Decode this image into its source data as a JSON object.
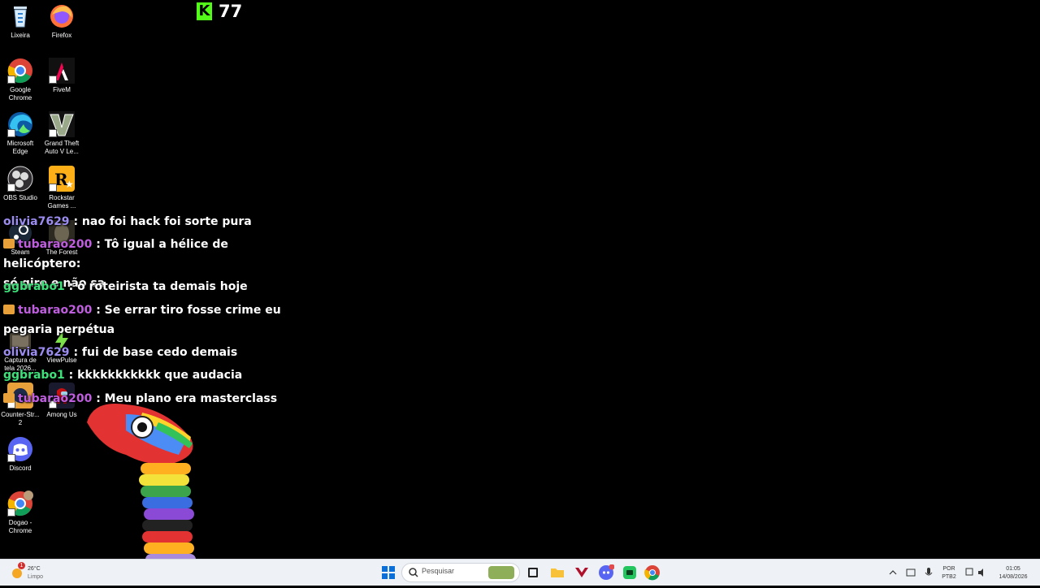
{
  "desktop": {
    "icons": [
      {
        "label": "Lixeira"
      },
      {
        "label": "Firefox"
      },
      {
        "label": "Google Chrome"
      },
      {
        "label": "FiveM"
      },
      {
        "label": "Microsoft Edge"
      },
      {
        "label": "Grand Theft Auto V Le..."
      },
      {
        "label": "OBS Studio"
      },
      {
        "label": "Rockstar Games ..."
      },
      {
        "label": "Steam"
      },
      {
        "label": "The Forest"
      },
      {
        "label": "Captura de tela 2026..."
      },
      {
        "label": "ViewPulse"
      },
      {
        "label": "Counter-Str... 2"
      },
      {
        "label": "Among Us"
      },
      {
        "label": "Discord"
      },
      {
        "label": "Dogao - Chrome"
      }
    ]
  },
  "counter": {
    "logo_letter": "K",
    "value": "77",
    "logo_color": "#53fc18"
  },
  "chat": {
    "clipped_line": "... ...",
    "messages": [
      {
        "user": "olivia7629",
        "color": "#9b8cf0",
        "text": ": nao foi hack foi sorte pura",
        "badge": false
      },
      {
        "user": "tubarao200",
        "color": "#c05ee0",
        "text": ": Tô igual a hélice de helicóptero:",
        "text2": "só giro e não sa",
        "badge": true
      },
      {
        "user": "ggbrabo1",
        "color": "#3ee07a",
        "text": ": o roteirista ta demais hoje",
        "badge": false
      },
      {
        "user": "tubarao200",
        "color": "#c05ee0",
        "text": ": Se errar tiro fosse crime eu",
        "text2": "pegaria perpétua",
        "badge": true
      },
      {
        "user": "olivia7629",
        "color": "#9b8cf0",
        "text": ": fui de base cedo demais",
        "badge": false
      },
      {
        "user": "ggbrabo1",
        "color": "#3ee07a",
        "text": ": kkkkkkkkkkk que audacia",
        "badge": false
      },
      {
        "user": "tubarao200",
        "color": "#c05ee0",
        "text": ": Meu plano era masterclass",
        "badge": true
      }
    ]
  },
  "taskbar": {
    "weather": {
      "temp": "26°C",
      "cond": "Limpo",
      "alert": "1"
    },
    "search_placeholder": "Pesquisar",
    "lang": {
      "line1": "POR",
      "line2": "PTB2"
    },
    "clock": {
      "time": "01:05",
      "date": "14/08/2026"
    }
  }
}
